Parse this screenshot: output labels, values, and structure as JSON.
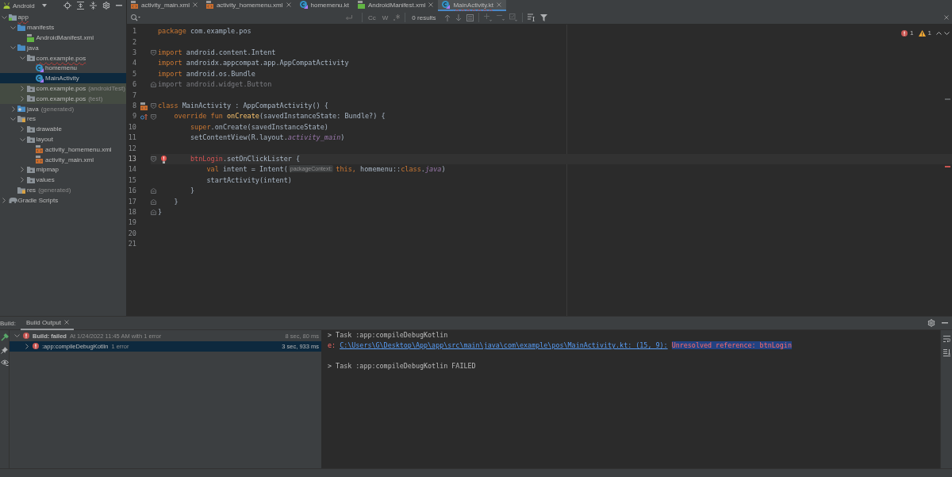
{
  "project_panel": {
    "view": "Android",
    "tree": [
      {
        "label": "app",
        "kind": "module",
        "expanded": true,
        "selected": false,
        "has_error": true,
        "children": [
          {
            "label": "manifests",
            "kind": "folder",
            "expanded": true,
            "selected": false,
            "has_error": false,
            "children": [
              {
                "label": "AndroidManifest.xml",
                "kind": "manifest",
                "selected": false,
                "has_error": false
              }
            ]
          },
          {
            "label": "java",
            "kind": "folder",
            "expanded": true,
            "selected": false,
            "has_error": false,
            "children": [
              {
                "label": "com.example.pos",
                "kind": "package",
                "expanded": true,
                "selected": false,
                "has_error": true,
                "test_scope": false,
                "children": [
                  {
                    "label": "homemenu",
                    "kind": "kotlin",
                    "selected": false,
                    "has_error": false
                  },
                  {
                    "label": "MainActivity",
                    "kind": "kotlin",
                    "selected": true,
                    "has_error": false
                  }
                ]
              },
              {
                "label": "com.example.pos",
                "suffix": "(androidTest)",
                "kind": "package",
                "expanded": false,
                "selected": false,
                "has_error": false,
                "test_scope": true
              },
              {
                "label": "com.example.pos",
                "suffix": "(test)",
                "kind": "package",
                "expanded": false,
                "selected": false,
                "has_error": false,
                "test_scope": true
              }
            ]
          },
          {
            "label": "java",
            "suffix": "(generated)",
            "kind": "generated",
            "expanded": false,
            "selected": false,
            "has_error": false
          },
          {
            "label": "res",
            "kind": "res",
            "expanded": true,
            "selected": false,
            "has_error": false,
            "children": [
              {
                "label": "drawable",
                "kind": "directory",
                "expanded": false,
                "selected": false,
                "has_error": false
              },
              {
                "label": "layout",
                "kind": "directory",
                "expanded": true,
                "selected": false,
                "has_error": false,
                "children": [
                  {
                    "label": "activity_homemenu.xml",
                    "kind": "layout",
                    "selected": false,
                    "has_error": false
                  },
                  {
                    "label": "activity_main.xml",
                    "kind": "layout",
                    "selected": false,
                    "has_error": false
                  }
                ]
              },
              {
                "label": "mipmap",
                "kind": "directory",
                "expanded": false,
                "selected": false,
                "has_error": false
              },
              {
                "label": "values",
                "kind": "directory",
                "expanded": false,
                "selected": false,
                "has_error": false
              }
            ]
          },
          {
            "label": "res",
            "suffix": "(generated)",
            "kind": "res",
            "selected": false,
            "has_error": false
          }
        ]
      },
      {
        "label": "Gradle Scripts",
        "kind": "gradle",
        "expanded": false,
        "selected": false,
        "has_error": false
      }
    ]
  },
  "editor_tabs": [
    {
      "label": "activity_main.xml",
      "kind": "layout",
      "selected": false,
      "has_error": false,
      "closable": true
    },
    {
      "label": "activity_homemenu.xml",
      "kind": "layout",
      "selected": false,
      "has_error": false,
      "closable": true
    },
    {
      "label": "homemenu.kt",
      "kind": "kotlin",
      "selected": false,
      "has_error": false,
      "closable": false
    },
    {
      "label": "AndroidManifest.xml",
      "kind": "manifest",
      "selected": false,
      "has_error": false,
      "closable": true
    },
    {
      "label": "MainActivity.kt",
      "kind": "kotlin",
      "selected": true,
      "has_error": true,
      "closable": true
    }
  ],
  "find_bar": {
    "options": [
      {
        "label": "Cc",
        "selected": false
      },
      {
        "label": "W",
        "selected": false
      }
    ],
    "results": "0 results"
  },
  "editor": {
    "inspections": {
      "errors": "1",
      "warnings": "1"
    },
    "lines": [
      {
        "number": "1",
        "current": false,
        "tokens": [
          {
            "text": "package",
            "kind": "keyword"
          },
          {
            "text": " com.example.pos",
            "kind": "plain"
          }
        ]
      },
      {
        "number": "2",
        "current": false
      },
      {
        "number": "3",
        "current": false,
        "gutter": [
          {
            "kind": "fold_start"
          }
        ],
        "tokens": [
          {
            "text": "import",
            "kind": "keyword"
          },
          {
            "text": " android.content.Intent",
            "kind": "plain"
          }
        ]
      },
      {
        "number": "4",
        "current": false,
        "tokens": [
          {
            "text": "import",
            "kind": "keyword"
          },
          {
            "text": " androidx.appcompat.app.AppCompatActivity",
            "kind": "plain"
          }
        ]
      },
      {
        "number": "5",
        "current": false,
        "tokens": [
          {
            "text": "import",
            "kind": "keyword"
          },
          {
            "text": " android.os.Bundle",
            "kind": "plain"
          }
        ]
      },
      {
        "number": "6",
        "current": false,
        "gutter": [
          {
            "kind": "fold_end"
          }
        ],
        "tokens": [
          {
            "text": "import android.widget.Button",
            "kind": "unused"
          }
        ]
      },
      {
        "number": "7",
        "current": false
      },
      {
        "number": "8",
        "current": false,
        "gutter": [
          {
            "kind": "layout"
          },
          {
            "kind": "fold_start"
          }
        ],
        "tokens": [
          {
            "text": "class",
            "kind": "keyword"
          },
          {
            "text": " MainActivity : AppCompatActivity() {",
            "kind": "plain"
          }
        ]
      },
      {
        "number": "9",
        "current": false,
        "gutter": [
          {
            "kind": "override"
          },
          {
            "kind": "fold_start"
          }
        ],
        "tokens": [
          {
            "text": "    override fun ",
            "kind": "keyword"
          },
          {
            "text": "onCreate",
            "kind": "function"
          },
          {
            "text": "(savedInstanceState: Bundle?) {",
            "kind": "plain"
          }
        ]
      },
      {
        "number": "10",
        "current": false,
        "tokens": [
          {
            "text": "        super",
            "kind": "keyword"
          },
          {
            "text": ".onCreate(savedInstanceState)",
            "kind": "plain"
          }
        ]
      },
      {
        "number": "11",
        "current": false,
        "tokens": [
          {
            "text": "        setContentView(R.layout.",
            "kind": "plain"
          },
          {
            "text": "activity_main",
            "kind": "field"
          },
          {
            "text": ")",
            "kind": "plain"
          }
        ]
      },
      {
        "number": "12",
        "current": false
      },
      {
        "number": "13",
        "current": true,
        "gutter": [
          {
            "kind": "fold_start"
          },
          {
            "kind": "error_bulb"
          }
        ],
        "tokens": [
          {
            "text": "        btnLogin",
            "kind": "error"
          },
          {
            "text": ".setOnClickLister {",
            "kind": "plain"
          }
        ]
      },
      {
        "number": "14",
        "current": false,
        "tokens": [
          {
            "text": "            val",
            "kind": "keyword"
          },
          {
            "text": " intent = Intent(",
            "kind": "plain"
          },
          {
            "text": "packageContext:",
            "kind": "hint"
          },
          {
            "text": "this,",
            "kind": "keyword"
          },
          {
            "text": " homemenu::",
            "kind": "plain"
          },
          {
            "text": "class",
            "kind": "keyword"
          },
          {
            "text": ".",
            "kind": "plain"
          },
          {
            "text": "java",
            "kind": "field"
          },
          {
            "text": ")",
            "kind": "plain"
          }
        ]
      },
      {
        "number": "15",
        "current": false,
        "tokens": [
          {
            "text": "            startActivity(intent)",
            "kind": "plain"
          }
        ]
      },
      {
        "number": "16",
        "current": false,
        "gutter": [
          {
            "kind": "fold_end"
          }
        ],
        "tokens": [
          {
            "text": "        }",
            "kind": "plain"
          }
        ]
      },
      {
        "number": "17",
        "current": false,
        "gutter": [
          {
            "kind": "fold_end"
          }
        ],
        "tokens": [
          {
            "text": "    }",
            "kind": "plain"
          }
        ]
      },
      {
        "number": "18",
        "current": false,
        "gutter": [
          {
            "kind": "fold_end"
          }
        ],
        "tokens": [
          {
            "text": "}",
            "kind": "plain"
          }
        ]
      },
      {
        "number": "19",
        "current": false
      },
      {
        "number": "20",
        "current": false
      },
      {
        "number": "21",
        "current": false
      }
    ]
  },
  "build": {
    "title": "Build:",
    "tabs": [
      {
        "label": "Build Output",
        "selected": true
      }
    ],
    "tree": [
      {
        "title": "Build: failed",
        "detail": "At 1/24/2022 11:45 AM with 1 error",
        "time": "8 sec, 80 ms",
        "kind": "failed",
        "expanded": true,
        "selected": false,
        "children": [
          {
            "title": ":app:compileDebugKotlin",
            "detail": "1 error",
            "time": "3 sec, 933 ms",
            "kind": "failed",
            "expanded": false,
            "selected": true
          }
        ]
      }
    ],
    "console": [
      {
        "kind": "text",
        "text": "> Task :app:compileDebugKotlin"
      },
      {
        "kind": "error",
        "prefix": "e:",
        "link": "C:\\Users\\G\\Desktop\\App\\app\\src\\main\\java\\com\\example\\pos\\MainActivity.kt: (15, 9):",
        "message": "Unresolved reference: btnLogin"
      },
      {
        "kind": "blank"
      },
      {
        "kind": "text",
        "text": "> Task :app:compileDebugKotlin FAILED"
      }
    ]
  }
}
